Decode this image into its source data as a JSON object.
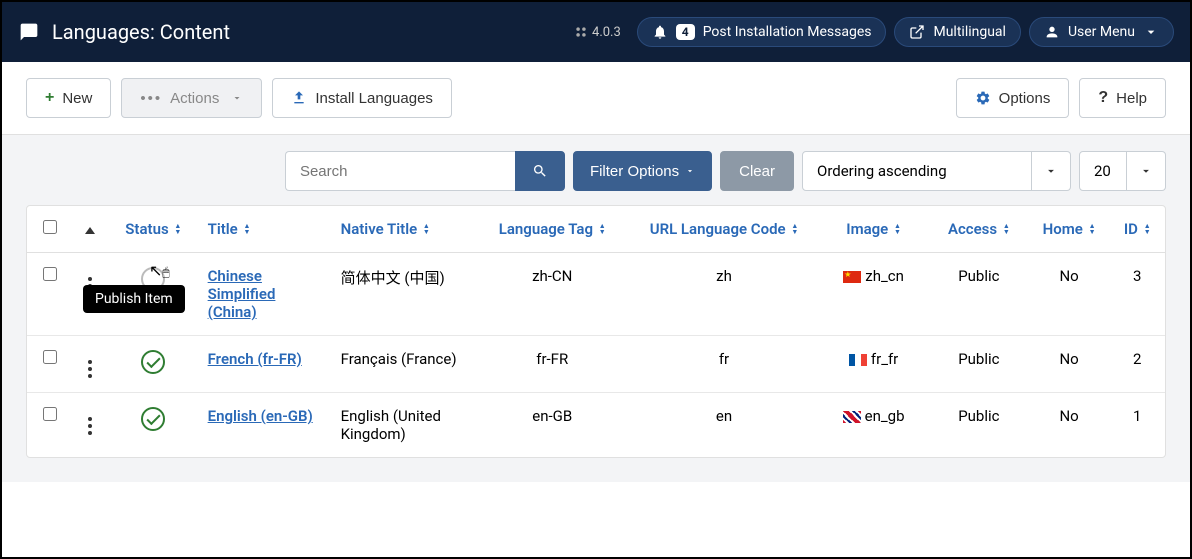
{
  "header": {
    "title": "Languages: Content",
    "version": "4.0.3",
    "notif_count": "4",
    "notif_label": "Post Installation Messages",
    "multilingual_label": "Multilingual",
    "user_menu_label": "User Menu"
  },
  "toolbar": {
    "new_label": "New",
    "actions_label": "Actions",
    "install_label": "Install Languages",
    "options_label": "Options",
    "help_label": "Help"
  },
  "filter": {
    "search_placeholder": "Search",
    "filter_options_label": "Filter Options",
    "clear_label": "Clear",
    "ordering_label": "Ordering ascending",
    "limit_label": "20"
  },
  "tooltip_text": "Publish Item",
  "columns": {
    "status": "Status",
    "title": "Title",
    "native": "Native Title",
    "tag": "Language Tag",
    "url": "URL Language Code",
    "image": "Image",
    "access": "Access",
    "home": "Home",
    "id": "ID"
  },
  "rows": [
    {
      "published": false,
      "title": "Chinese Simplified (China)",
      "native": "简体中文 (中国)",
      "tag": "zh-CN",
      "url": "zh",
      "flag": "cn",
      "image_code": "zh_cn",
      "access": "Public",
      "home": "No",
      "id": "3"
    },
    {
      "published": true,
      "title": "French (fr-FR)",
      "native": "Français (France)",
      "tag": "fr-FR",
      "url": "fr",
      "flag": "fr",
      "image_code": "fr_fr",
      "access": "Public",
      "home": "No",
      "id": "2"
    },
    {
      "published": true,
      "title": "English (en-GB)",
      "native": "English (United Kingdom)",
      "tag": "en-GB",
      "url": "en",
      "flag": "gb",
      "image_code": "en_gb",
      "access": "Public",
      "home": "No",
      "id": "1"
    }
  ]
}
